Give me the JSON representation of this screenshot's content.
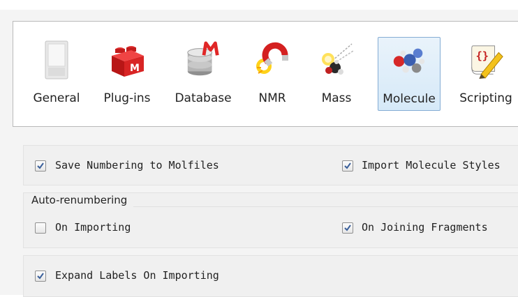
{
  "toolbar": {
    "items": [
      {
        "label": "General",
        "icon": "switch-icon"
      },
      {
        "label": "Plug-ins",
        "icon": "lego-brick-icon"
      },
      {
        "label": "Database",
        "icon": "database-icon"
      },
      {
        "label": "NMR",
        "icon": "magnet-icon"
      },
      {
        "label": "Mass",
        "icon": "mass-spec-icon"
      },
      {
        "label": "Molecule",
        "icon": "molecule-icon",
        "active": true
      },
      {
        "label": "Scripting",
        "icon": "script-icon"
      }
    ]
  },
  "options": {
    "save_numbering": {
      "label": "Save Numbering to Molfiles",
      "checked": true
    },
    "import_styles": {
      "label": "Import Molecule Styles",
      "checked": true
    },
    "auto_renumbering": {
      "title": "Auto-renumbering",
      "on_importing": {
        "label": "On Importing",
        "checked": false
      },
      "on_joining": {
        "label": "On Joining Fragments",
        "checked": true
      }
    },
    "expand_labels": {
      "label": "Expand Labels On Importing",
      "checked": true
    }
  },
  "colors": {
    "accent": "#84acd4",
    "check": "#3a5f9a"
  }
}
